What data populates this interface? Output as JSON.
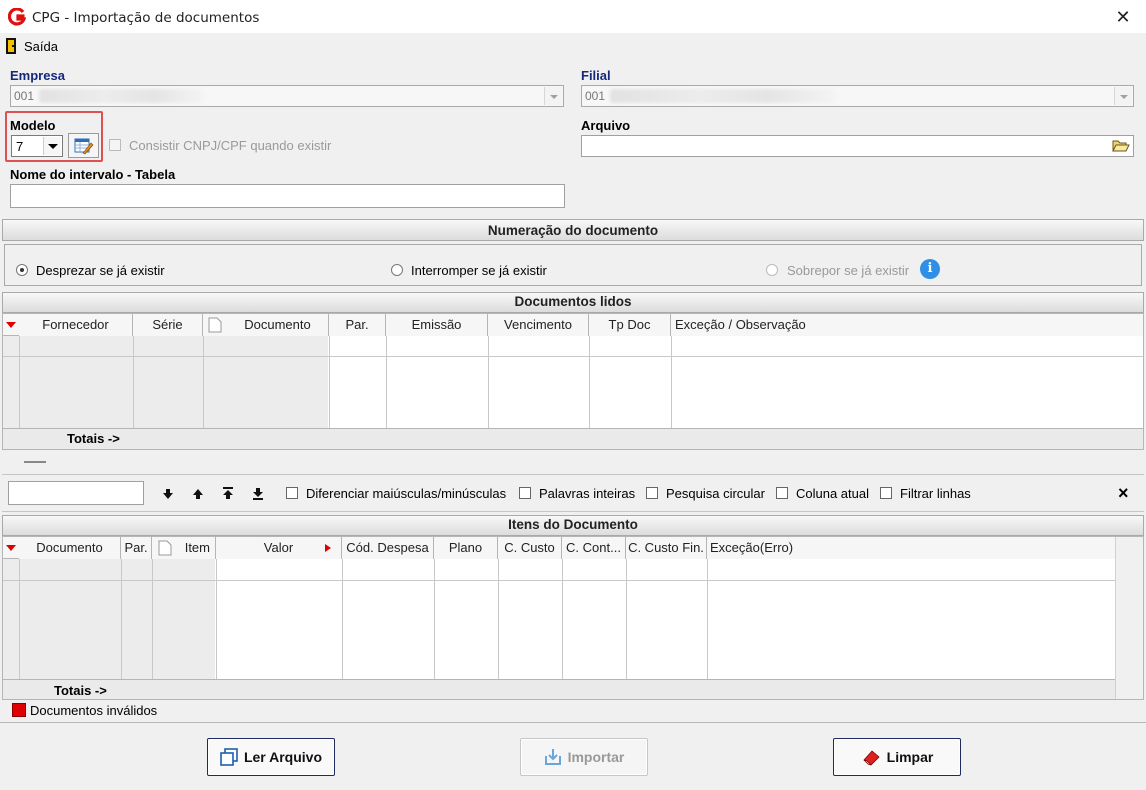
{
  "window": {
    "title": "CPG - Importação de documentos"
  },
  "menu": {
    "exit": "Saída"
  },
  "empresa": {
    "label": "Empresa",
    "value": "001"
  },
  "filial": {
    "label": "Filial",
    "value": "001"
  },
  "modelo": {
    "label": "Modelo",
    "value": "7"
  },
  "consistir": {
    "label": "Consistir CNPJ/CPF quando existir"
  },
  "arquivo": {
    "label": "Arquivo",
    "value": ""
  },
  "intervalo": {
    "label": "Nome do intervalo - Tabela",
    "value": ""
  },
  "numeracao": {
    "title": "Numeração do documento",
    "options": [
      "Desprezar se já existir",
      "Interromper se já existir",
      "Sobrepor se já existir"
    ],
    "selected": 0
  },
  "docs_lidos": {
    "title": "Documentos lidos",
    "columns": [
      "Fornecedor",
      "Série",
      "Documento",
      "Par.",
      "Emissão",
      "Vencimento",
      "Tp Doc",
      "Exceção / Observação"
    ],
    "totals": "Totais ->"
  },
  "search": {
    "value": "",
    "options": [
      "Diferenciar maiúsculas/minúsculas",
      "Palavras inteiras",
      "Pesquisa circular",
      "Coluna atual",
      "Filtrar linhas"
    ],
    "close": "×"
  },
  "itens": {
    "title": "Itens do Documento",
    "columns": [
      "Documento",
      "Par.",
      "Item",
      "Valor",
      "Cód. Despesa",
      "Plano",
      "C. Custo",
      "C. Cont...",
      "C. Custo Fin.",
      "Exceção(Erro)"
    ],
    "totals": "Totais ->"
  },
  "legend": {
    "label": "Documentos inválidos",
    "color": "#e00000"
  },
  "buttons": {
    "ler": "Ler Arquivo",
    "importar": "Importar",
    "limpar": "Limpar"
  },
  "colors": {
    "accent_label": "#14297a",
    "highlight_box": "#e05050"
  }
}
